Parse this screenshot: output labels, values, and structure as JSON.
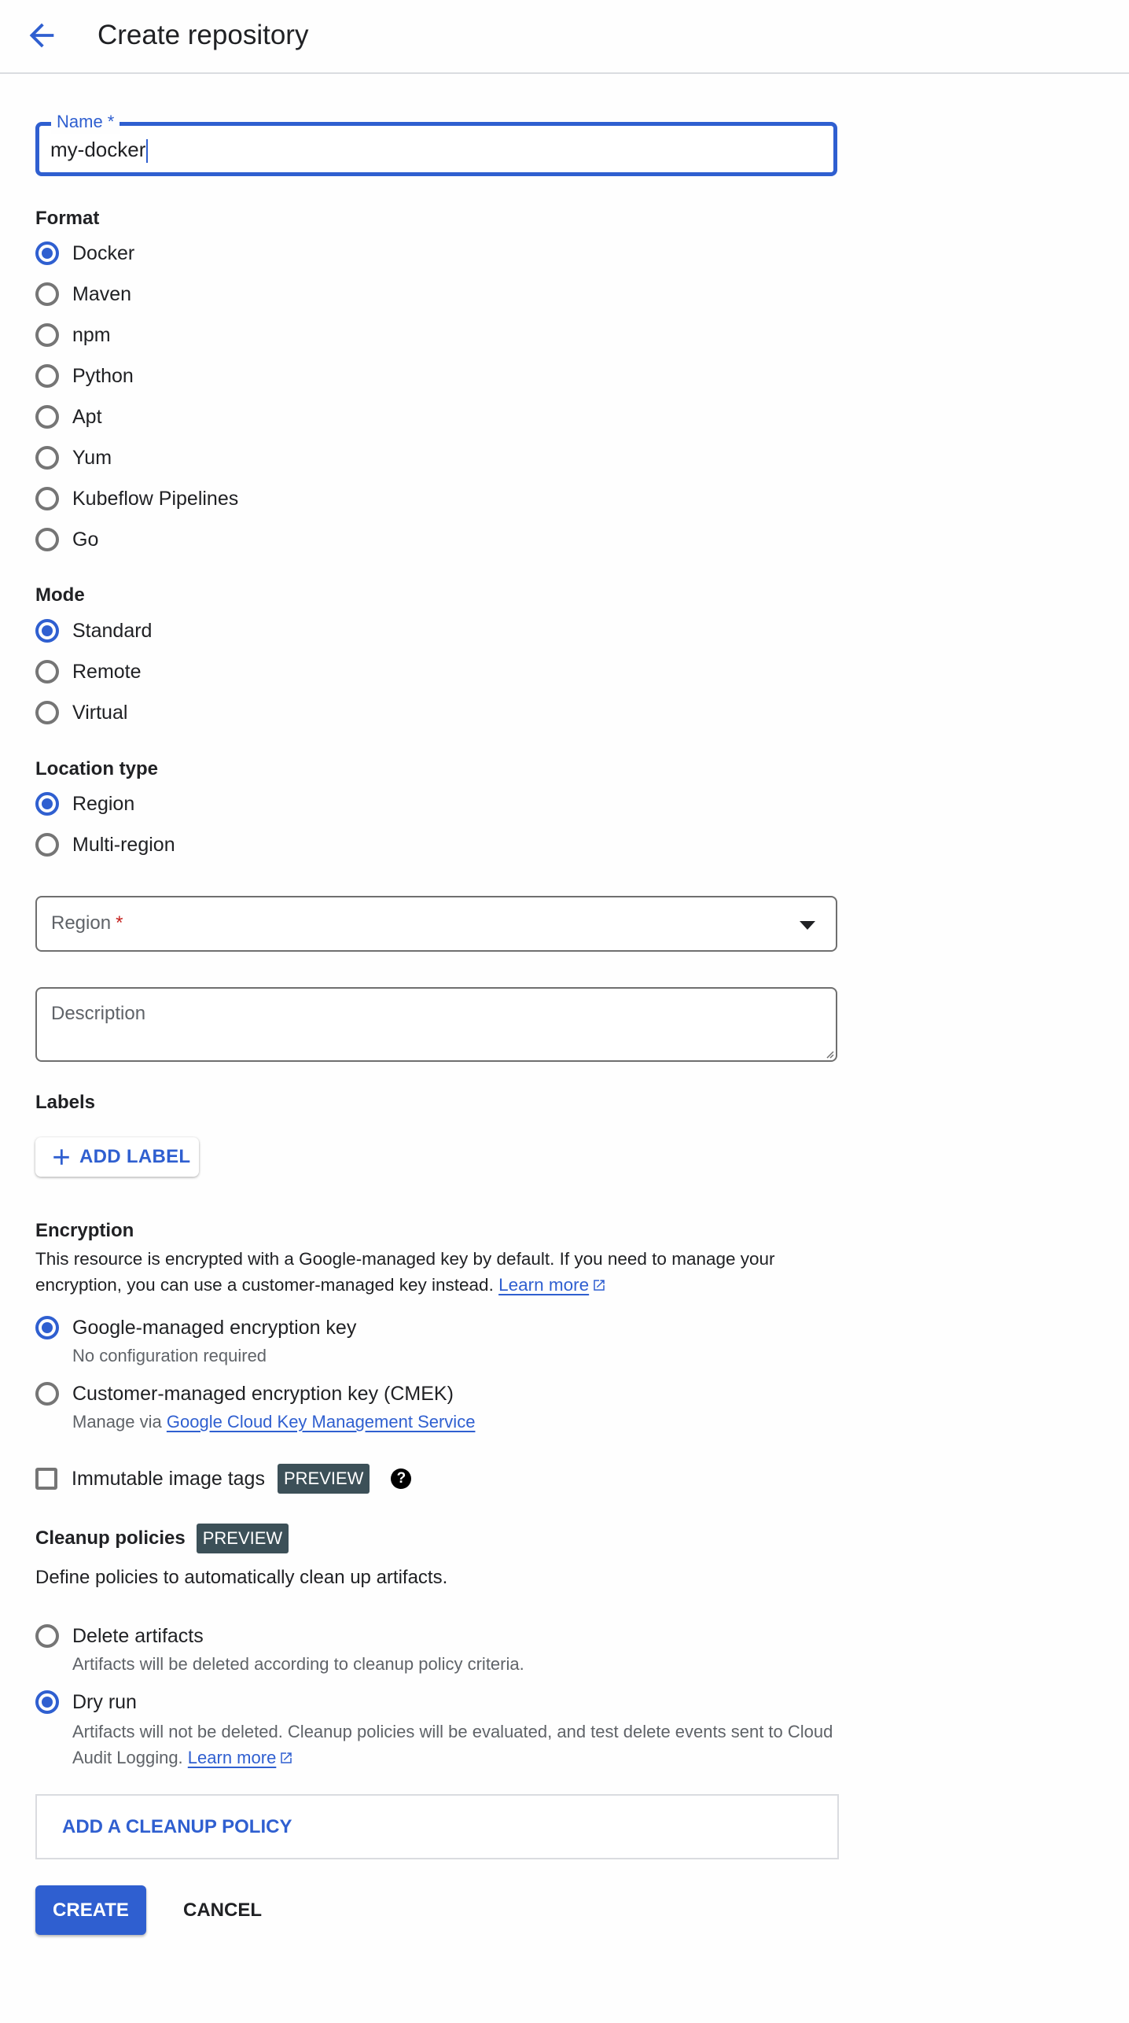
{
  "header": {
    "title": "Create repository",
    "back_icon": "arrow-left-icon"
  },
  "name_field": {
    "label": "Name *",
    "value": "my-docker"
  },
  "format": {
    "label": "Format",
    "options": [
      "Docker",
      "Maven",
      "npm",
      "Python",
      "Apt",
      "Yum",
      "Kubeflow Pipelines",
      "Go"
    ],
    "selected": "Docker"
  },
  "mode": {
    "label": "Mode",
    "options": [
      "Standard",
      "Remote",
      "Virtual"
    ],
    "selected": "Standard"
  },
  "location_type": {
    "label": "Location type",
    "options": [
      "Region",
      "Multi-region"
    ],
    "selected": "Region"
  },
  "region_select": {
    "placeholder": "Region",
    "required_mark": "*"
  },
  "description": {
    "placeholder": "Description"
  },
  "labels": {
    "heading": "Labels",
    "add_button": "ADD LABEL"
  },
  "encryption": {
    "heading": "Encryption",
    "text": "This resource is encrypted with a Google-managed key by default. If you need to manage your encryption, you can use a customer-managed key instead.",
    "learn_more": "Learn more",
    "options": [
      {
        "label": "Google-managed encryption key",
        "sub": "No configuration required"
      },
      {
        "label": "Customer-managed encryption key (CMEK)",
        "sub_prefix": "Manage via",
        "sub_link": "Google Cloud Key Management Service"
      }
    ],
    "selected": "Google-managed encryption key"
  },
  "immutable_tags": {
    "label": "Immutable image tags",
    "badge": "PREVIEW",
    "checked": false,
    "help_glyph": "?"
  },
  "cleanup": {
    "heading": "Cleanup policies",
    "badge": "PREVIEW",
    "description": "Define policies to automatically clean up artifacts.",
    "options": [
      {
        "label": "Delete artifacts",
        "sub": "Artifacts will be deleted according to cleanup policy criteria."
      },
      {
        "label": "Dry run",
        "sub": "Artifacts will not be deleted. Cleanup policies will be evaluated, and test delete events sent to Cloud Audit Logging.",
        "learn_more": "Learn more"
      }
    ],
    "selected": "Dry run",
    "add_policy": "ADD A CLEANUP POLICY"
  },
  "actions": {
    "create": "CREATE",
    "cancel": "CANCEL"
  },
  "colors": {
    "accent": "#2f5fd0",
    "badge_bg": "#3c5058",
    "required": "#c5221f"
  }
}
